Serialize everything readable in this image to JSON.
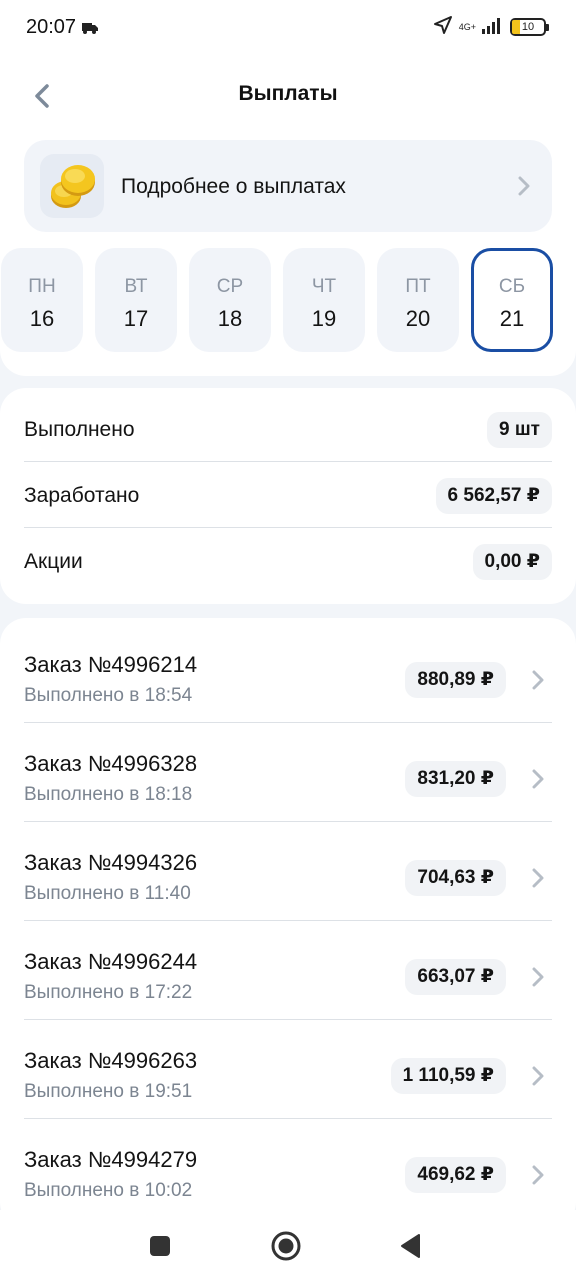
{
  "status_bar": {
    "time": "20:07",
    "network": "4G+",
    "battery": "10",
    "icons": [
      "truck-icon",
      "location-arrow-icon",
      "signal-icon",
      "battery-icon"
    ]
  },
  "header": {
    "title": "Выплаты",
    "back_icon": "chevron-left-icon"
  },
  "info_card": {
    "text": "Подробнее о выплатах",
    "icon": "coins-icon"
  },
  "days": [
    {
      "name": "ПН",
      "num": "16",
      "selected": false
    },
    {
      "name": "ВТ",
      "num": "17",
      "selected": false
    },
    {
      "name": "СР",
      "num": "18",
      "selected": false
    },
    {
      "name": "ЧТ",
      "num": "19",
      "selected": false
    },
    {
      "name": "ПТ",
      "num": "20",
      "selected": false
    },
    {
      "name": "СБ",
      "num": "21",
      "selected": true
    }
  ],
  "summary": {
    "completed_label": "Выполнено",
    "completed_value": "9 шт",
    "earned_label": "Заработано",
    "earned_value": "6 562,57 ₽",
    "promo_label": "Акции",
    "promo_value": "0,00 ₽"
  },
  "orders": [
    {
      "title": "Заказ №4996214",
      "sub": "Выполнено в 18:54",
      "amount": "880,89 ₽"
    },
    {
      "title": "Заказ №4996328",
      "sub": "Выполнено в 18:18",
      "amount": "831,20 ₽"
    },
    {
      "title": "Заказ №4994326",
      "sub": "Выполнено в 11:40",
      "amount": "704,63 ₽"
    },
    {
      "title": "Заказ №4996244",
      "sub": "Выполнено в 17:22",
      "amount": "663,07 ₽"
    },
    {
      "title": "Заказ №4996263",
      "sub": "Выполнено в 19:51",
      "amount": "1 110,59 ₽"
    },
    {
      "title": "Заказ №4994279",
      "sub": "Выполнено в 10:02",
      "amount": "469,62 ₽"
    }
  ],
  "nav": {
    "icons": [
      "recents-square-icon",
      "home-circle-icon",
      "back-triangle-icon"
    ]
  },
  "colors": {
    "accent": "#1a4ea4",
    "background": "#f2f5f9",
    "pill": "#f1f3f6",
    "muted_text": "#7c8591"
  }
}
